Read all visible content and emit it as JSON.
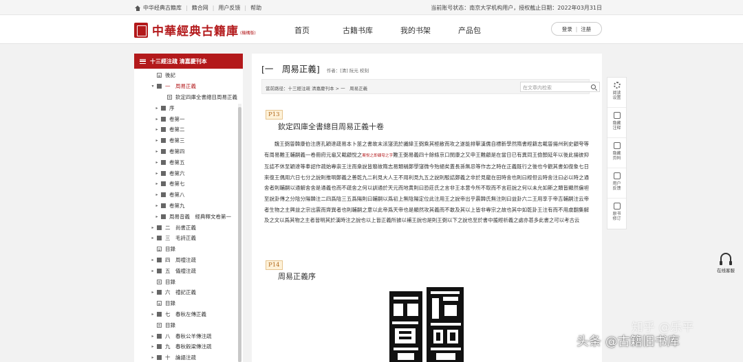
{
  "topbar": {
    "links": [
      "中华经典古籍库",
      "籍合网",
      "用户反馈",
      "帮助"
    ],
    "account": "当前账号状态：南京大学机构用户，授权截止日期：2022年03月31日"
  },
  "header": {
    "logo_text": "中華經典古籍庫",
    "logo_sub": "(機構版)",
    "nav": [
      "首页",
      "古籍书库",
      "我的书架",
      "产品包"
    ],
    "login": "登录",
    "register": "注册"
  },
  "sidebar": {
    "title": "十三經注疏 清嘉慶刊本",
    "items": [
      {
        "label": "後記",
        "icon": "page",
        "toggle": ""
      },
      {
        "label": "一　周易正義",
        "icon": "book",
        "toggle": "▾",
        "active": true
      },
      {
        "label": "欽定四庫全書總目周易正義",
        "icon": "page",
        "toggle": ""
      },
      {
        "label": "序",
        "icon": "book",
        "toggle": "▸"
      },
      {
        "label": "卷第一",
        "icon": "book",
        "toggle": "▸"
      },
      {
        "label": "卷第二",
        "icon": "book",
        "toggle": "▸"
      },
      {
        "label": "卷第三",
        "icon": "book",
        "toggle": "▸"
      },
      {
        "label": "卷第四",
        "icon": "book",
        "toggle": "▸"
      },
      {
        "label": "卷第五",
        "icon": "book",
        "toggle": "▸"
      },
      {
        "label": "卷第六",
        "icon": "book",
        "toggle": "▸"
      },
      {
        "label": "卷第七",
        "icon": "book",
        "toggle": "▸"
      },
      {
        "label": "卷第八",
        "icon": "book",
        "toggle": "▸"
      },
      {
        "label": "卷第九",
        "icon": "book",
        "toggle": "▸"
      },
      {
        "label": "周易音義　經典釋文卷第一",
        "icon": "book",
        "toggle": "▸"
      },
      {
        "label": "二　尚書正義",
        "icon": "book",
        "toggle": "▸"
      },
      {
        "label": "三　毛詩正義",
        "icon": "book",
        "toggle": "▸"
      },
      {
        "label": "目錄",
        "icon": "page",
        "toggle": ""
      },
      {
        "label": "四　周禮注疏",
        "icon": "book",
        "toggle": "▸"
      },
      {
        "label": "五　儀禮注疏",
        "icon": "book",
        "toggle": "▸"
      },
      {
        "label": "目錄",
        "icon": "page",
        "toggle": ""
      },
      {
        "label": "六　禮記正義",
        "icon": "book",
        "toggle": "▸"
      },
      {
        "label": "目錄",
        "icon": "page",
        "toggle": ""
      },
      {
        "label": "七　春秋左傳正義",
        "icon": "book",
        "toggle": "▸"
      },
      {
        "label": "目錄",
        "icon": "page",
        "toggle": ""
      },
      {
        "label": "八　春秋公羊傳注疏",
        "icon": "book",
        "toggle": "▸"
      },
      {
        "label": "九　春秋穀梁傳注疏",
        "icon": "book",
        "toggle": "▸"
      },
      {
        "label": "十　論語注疏",
        "icon": "book",
        "toggle": "▸"
      }
    ]
  },
  "main": {
    "title": "[一　周易正義]",
    "author": "作者：[清] 阮元 校刻",
    "breadcrumb": "當前路径：十三經注疏 清嘉慶刊本 > 一　周易正義",
    "search_placeholder": "在文章内检索",
    "p13": "P13",
    "heading1": "欽定四庫全書總目周易正義十卷",
    "para_a": "魏王弼晉韓康伯注唐孔穎達疏易本卜筮之書故末派寖流於讖緯王弼乘其極敝而攻之遂能排擊漢儒自標新學然隋書經籍志載晉揚州刺史顧夸等有周易難王輔嗣義一卷冊府元龜又載顧悅之",
    "note": "案悅之即顧夸之字",
    "para_b": "難王弼易義四十餘條京口閔康之又申王難顧是在當日已有異同王儉顏延年以後此揚彼抑互詰不休至穎達等奉詔作疏始專崇王注而衆說皆廢故隋志易類稱鄭學寖微今殆絕矣蓋長孫無忌等作志之時在正義既行之後也今觀其書如復象七日來復王偶用六日七分之說則推明鄭義之善乾九二利見大人王不用利見九五之說則駁詰鄭義之非於見龍在田時舍也則曰經但云時舍注曰必以時之通舍者則輔嗣以通解舍舍是通義也而不疏舍之何以訓通於天元而地黄則曰恐莊氏之言非王本意今所不取而不言莊說之何以未允如斯之類皆顯然偏袒至說卦傳之分陰分陽韓注二四爲陰三五爲陽則曰輔嗣以爲初上無陰陽定位此注用王之說帝出乎震韓氏無注則曰益卦六二王用享于帝吉輔嗣注云帝者生物之主興益之宗出震而齊巽者也則輔嗣之意以此帝爲天帝也是顯然攻其義而不敢及其以上皆非專宗之故也其中如乾卦王注有而不用虞翻集解及之文以爲其物之主者皆明其於漢時注之說也以上皆正義所據以補王說也是則王弼以下之說也至於書中援經析義之處亦甚多此書之可以考古云",
    "p14": "P14",
    "heading2": "周易正義序"
  },
  "tools": [
    {
      "label": "阅读设置",
      "icon": "gear-icon"
    },
    {
      "label": "隐藏注释",
      "icon": "note-icon"
    },
    {
      "label": "隐藏页码",
      "icon": "page-icon"
    },
    {
      "label": "用户反馈",
      "icon": "edit-icon"
    },
    {
      "label": "原书修订",
      "icon": "doc-icon"
    }
  ],
  "service": "在线客服",
  "watermark_main": "头条 @古籍旧书库",
  "watermark_zhihu": "知乎 @乐平",
  "colors": {
    "brand_red": "#b3191b",
    "page_tag": "#b36a1d"
  }
}
